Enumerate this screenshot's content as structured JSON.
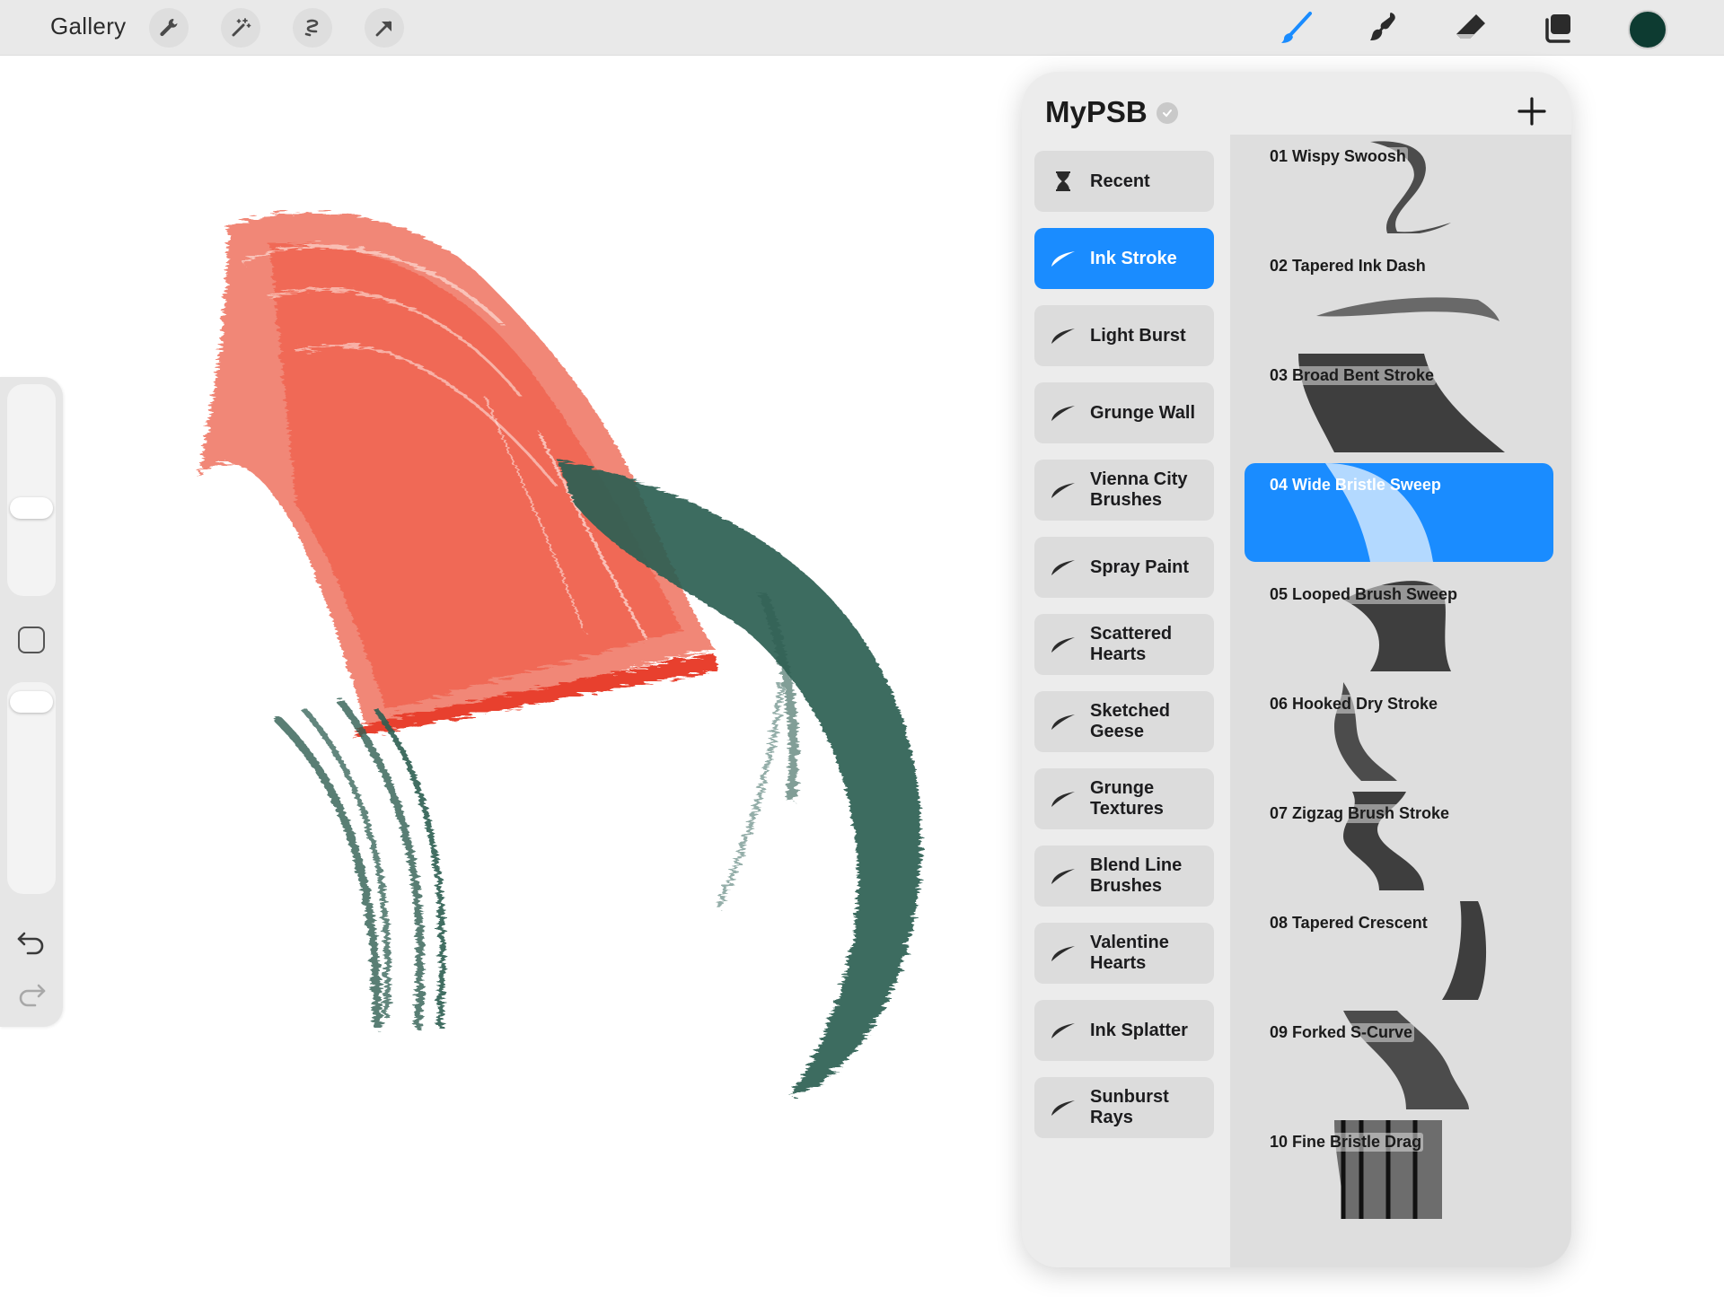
{
  "topbar": {
    "gallery_label": "Gallery",
    "left_tools": [
      "wrench-icon",
      "magic-wand-icon",
      "selection-icon",
      "transform-arrow-icon"
    ],
    "right_tools": [
      "paint-brush-icon",
      "smudge-icon",
      "eraser-icon",
      "layers-icon"
    ],
    "current_color": "#0d3b31"
  },
  "sidebar": {
    "brush_size_slider": "brush-size",
    "opacity_slider": "brush-opacity"
  },
  "library": {
    "title": "MyPSB",
    "sets": [
      {
        "label": "Recent",
        "icon": "hourglass-icon"
      },
      {
        "label": "Ink Stroke",
        "icon": "brush-stroke-icon",
        "active": true
      },
      {
        "label": "Light Burst",
        "icon": "brush-stroke-icon"
      },
      {
        "label": "Grunge Wall",
        "icon": "brush-stroke-icon"
      },
      {
        "label": "Vienna City Brushes",
        "icon": "brush-stroke-icon"
      },
      {
        "label": "Spray Paint",
        "icon": "brush-stroke-icon"
      },
      {
        "label": "Scattered Hearts",
        "icon": "brush-stroke-icon"
      },
      {
        "label": "Sketched Geese",
        "icon": "brush-stroke-icon"
      },
      {
        "label": "Grunge Textures",
        "icon": "brush-stroke-icon"
      },
      {
        "label": "Blend Line Brushes",
        "icon": "brush-stroke-icon"
      },
      {
        "label": "Valentine Hearts",
        "icon": "brush-stroke-icon"
      },
      {
        "label": "Ink Splatter",
        "icon": "brush-stroke-icon"
      },
      {
        "label": "Sunburst Rays",
        "icon": "brush-stroke-icon"
      }
    ],
    "brushes": [
      {
        "label": "01 Wispy Swoosh"
      },
      {
        "label": "02 Tapered Ink Dash"
      },
      {
        "label": "03 Broad Bent Stroke"
      },
      {
        "label": "04 Wide Bristle Sweep",
        "active": true
      },
      {
        "label": "05 Looped Brush Sweep"
      },
      {
        "label": "06 Hooked Dry Stroke"
      },
      {
        "label": "07 Zigzag Brush Stroke"
      },
      {
        "label": "08 Tapered Crescent"
      },
      {
        "label": "09 Forked S-Curve"
      },
      {
        "label": "10 Fine Bristle Drag"
      }
    ]
  },
  "colors": {
    "accent": "#1a8cff",
    "red_paint": "#f0604c",
    "green_paint": "#2e5e52"
  }
}
